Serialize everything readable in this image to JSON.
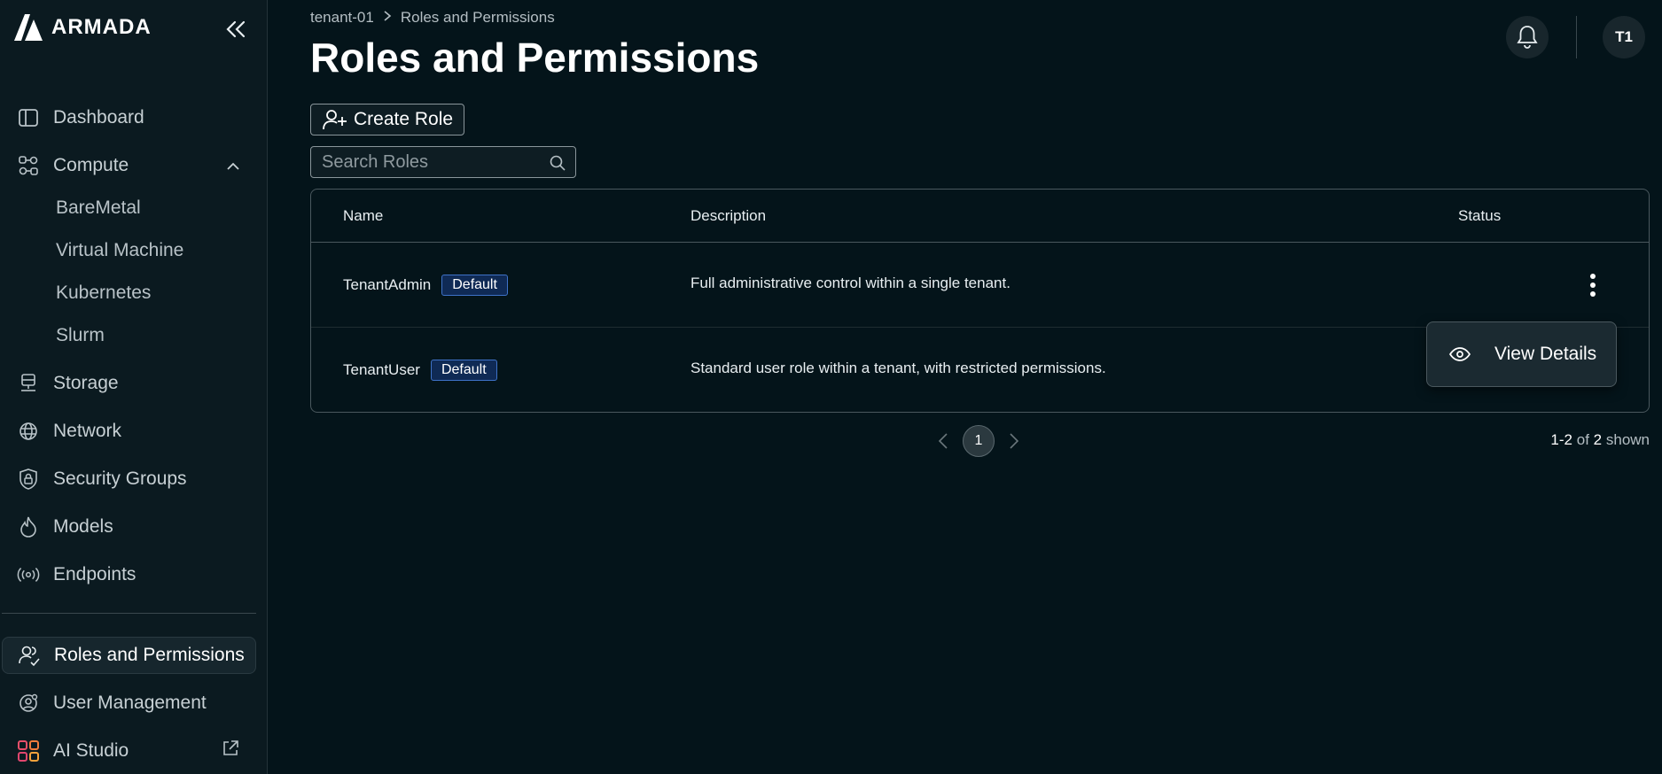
{
  "app": {
    "name": "ARMADA"
  },
  "sidebar": {
    "items": [
      {
        "label": "Dashboard",
        "icon": "layout-icon"
      },
      {
        "label": "Compute",
        "icon": "nodes-icon"
      },
      {
        "label": "Storage",
        "icon": "storage-icon"
      },
      {
        "label": "Network",
        "icon": "globe-icon"
      },
      {
        "label": "Security Groups",
        "icon": "shield-lock-icon"
      },
      {
        "label": "Models",
        "icon": "flame-icon"
      },
      {
        "label": "Endpoints",
        "icon": "broadcast-icon"
      },
      {
        "label": "Roles and Permissions",
        "icon": "users-icon"
      },
      {
        "label": "User Management",
        "icon": "user-gear-icon"
      },
      {
        "label": "AI Studio",
        "icon": "grid-icon"
      }
    ],
    "compute_sub": [
      "BareMetal",
      "Virtual Machine",
      "Kubernetes",
      "Slurm"
    ]
  },
  "breadcrumb": {
    "parent": "tenant-01",
    "current": "Roles and Permissions"
  },
  "page": {
    "title": "Roles and Permissions"
  },
  "header": {
    "avatar": "T1"
  },
  "toolbar": {
    "create_label": "Create Role"
  },
  "search": {
    "placeholder": "Search Roles"
  },
  "table": {
    "columns": [
      "Name",
      "Description",
      "Status"
    ],
    "rows": [
      {
        "name": "TenantAdmin",
        "badge": "Default",
        "description": "Full administrative control within a single tenant."
      },
      {
        "name": "TenantUser",
        "badge": "Default",
        "description": "Standard user role within a tenant, with restricted permissions."
      }
    ]
  },
  "menu": {
    "view_details": "View Details"
  },
  "pagination": {
    "page": "1",
    "range": "1-2",
    "of": "of",
    "total": "2",
    "suffix": "shown"
  },
  "colors": {
    "background": "#04141a",
    "sidebar": "#0b1a20",
    "badge_border": "#3e72c8"
  }
}
